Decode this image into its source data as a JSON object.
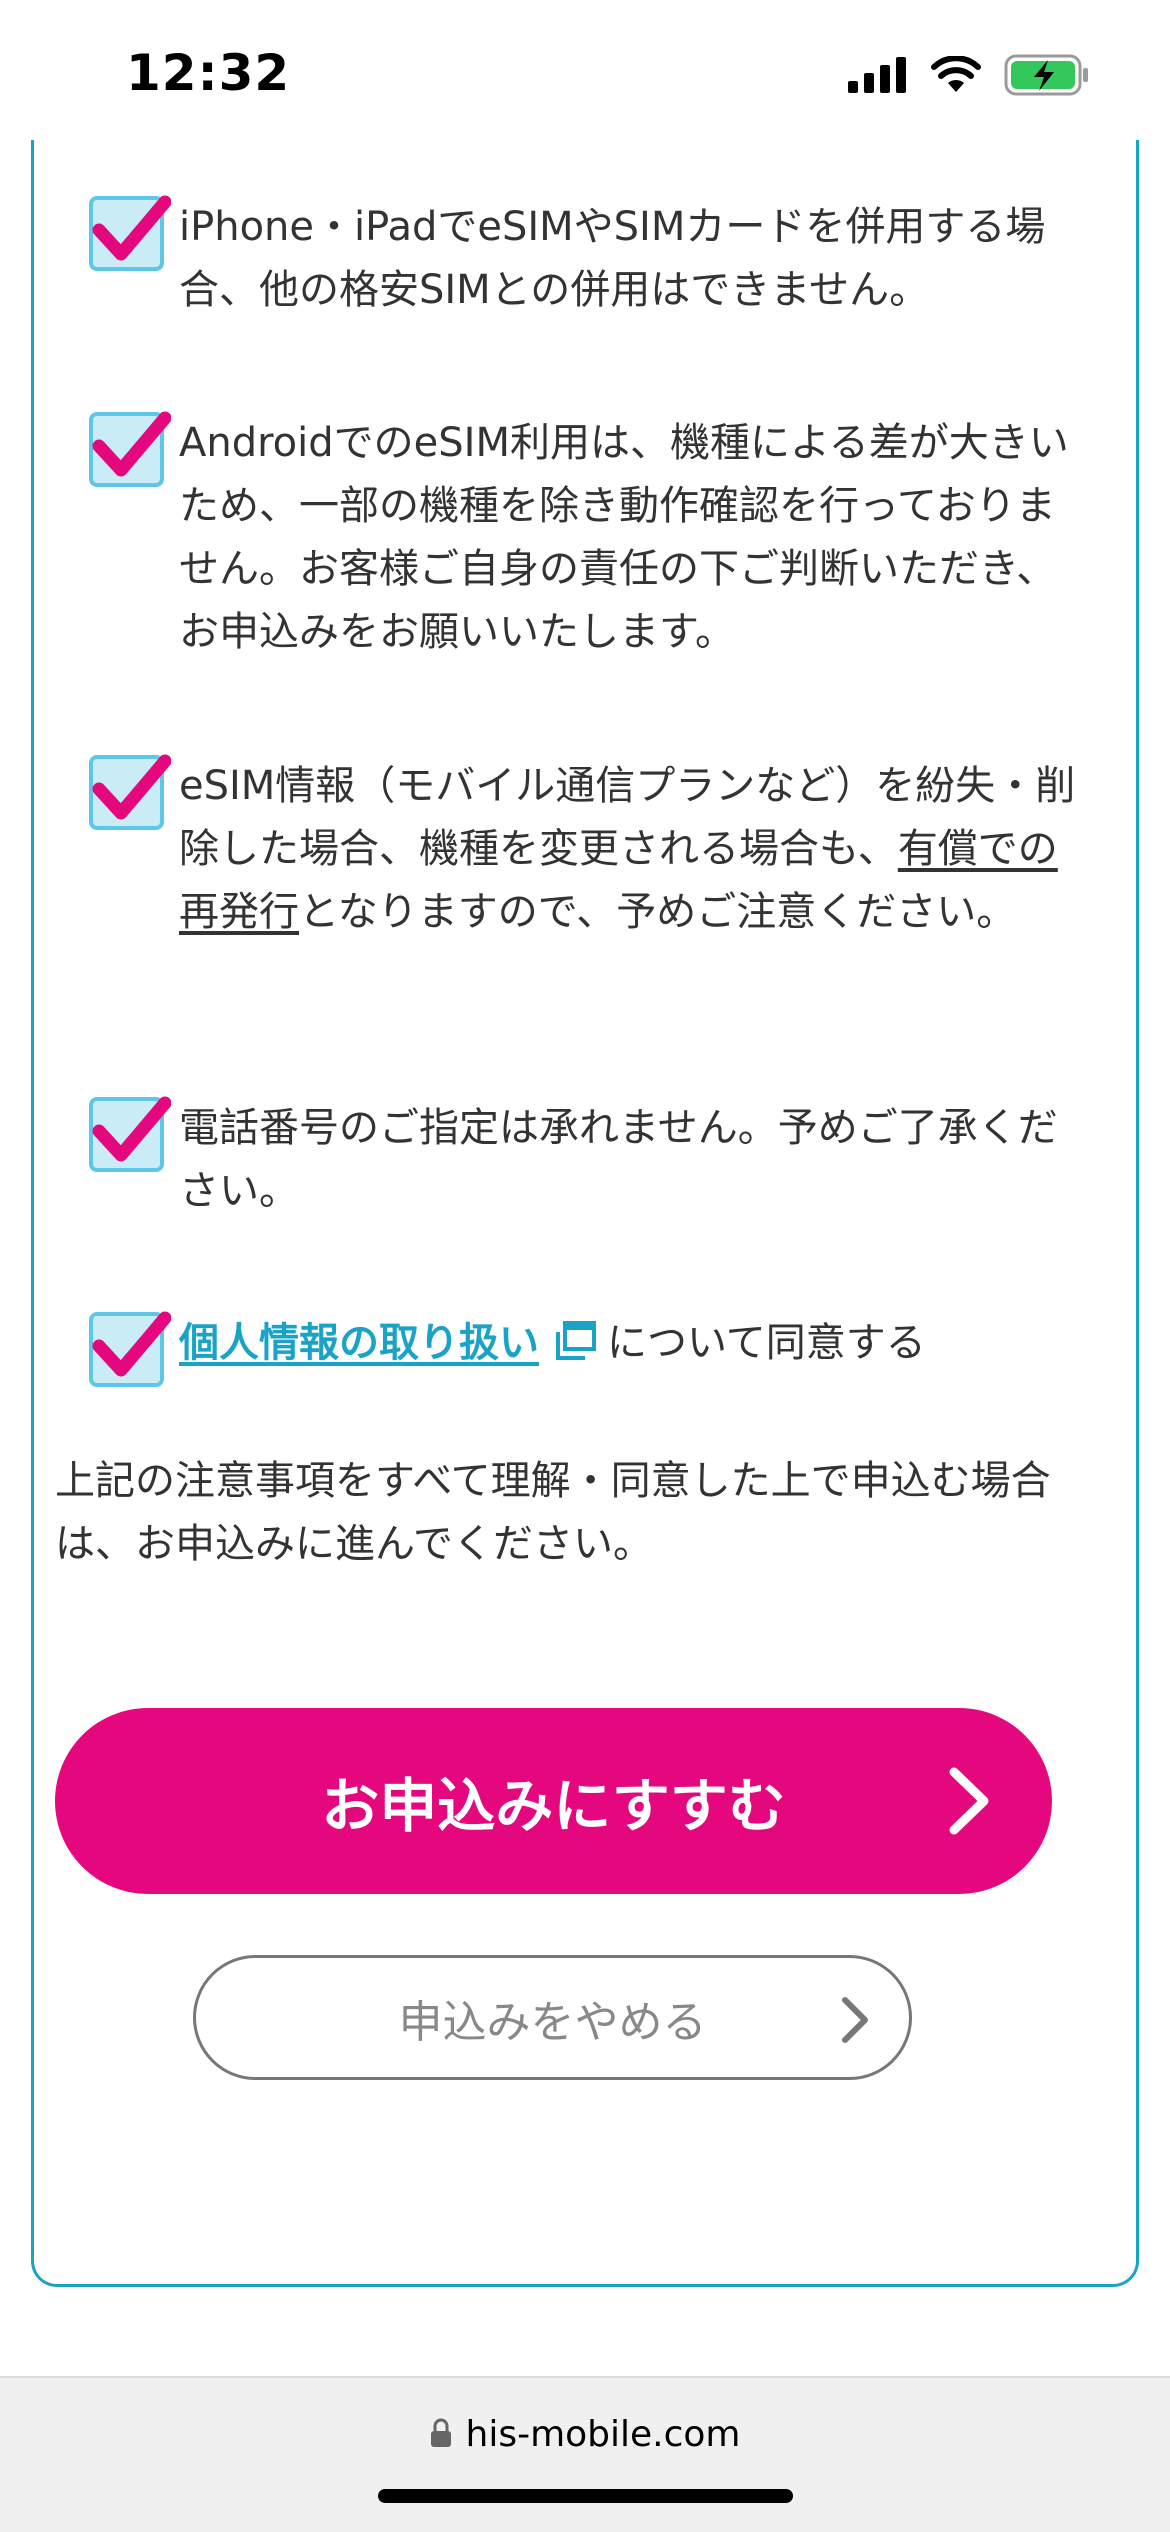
{
  "status_bar": {
    "time": "12:32"
  },
  "checklist": [
    {
      "text": "iPhone・iPadでeSIMやSIMカードを併用する場合、他の格安SIMとの併用はできません。",
      "checked": true
    },
    {
      "text": "AndroidでのeSIM利用は、機種による差が大きいため、一部の機種を除き動作確認を行っておりません。お客様ご自身の責任の下ご判断いただき、お申込みをお願いいたします。",
      "checked": true
    },
    {
      "text_before": "eSIM情報（モバイル通信プランなど）を紛失・削除した場合、機種を変更される場合も、",
      "text_underlined": "有償での再発行",
      "text_after": "となりますので、予めご注意ください。",
      "checked": true
    },
    {
      "text": "電話番号のご指定は承れません。予めご了承ください。",
      "checked": true
    },
    {
      "link_text": "個人情報の取り扱い",
      "text_after": "について同意する",
      "checked": true
    }
  ],
  "notice": "上記の注意事項をすべて理解・同意した上で申込む場合は、お申込みに進んでください。",
  "buttons": {
    "proceed_label": "お申込みにすすむ",
    "cancel_label": "申込みをやめる"
  },
  "browser": {
    "url": "his-mobile.com"
  },
  "colors": {
    "accent_pink": "#e5077d",
    "accent_cyan": "#1aa3c7",
    "checkbox_bg": "#c9ecf7"
  },
  "icons": [
    "signal-icon",
    "wifi-icon",
    "battery-charging-icon",
    "checkmark-icon",
    "external-link-icon",
    "chevron-right-icon",
    "lock-icon"
  ]
}
